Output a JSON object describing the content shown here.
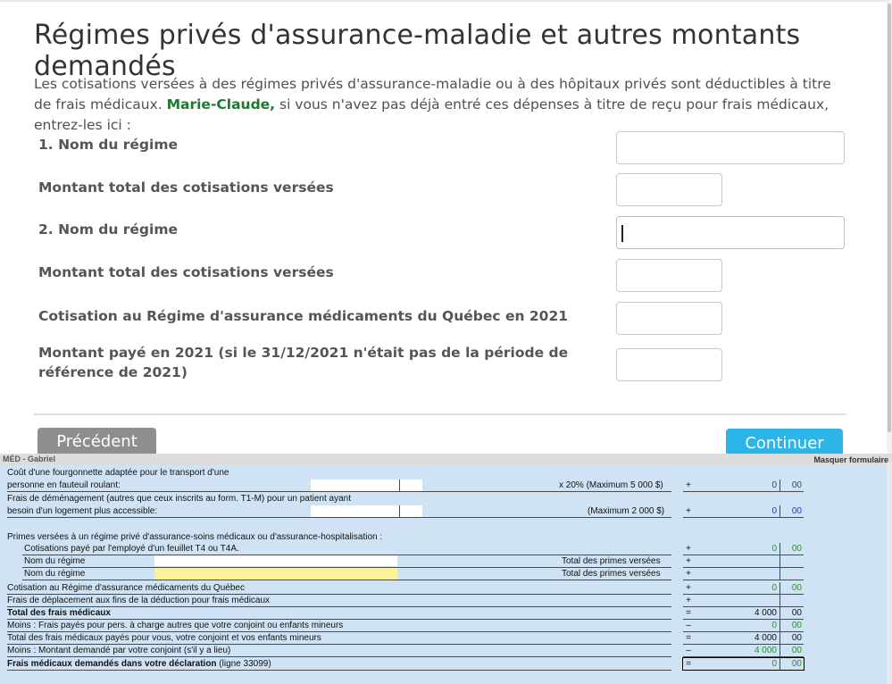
{
  "page": {
    "title": "Régimes privés d'assurance-maladie et autres montants demandés",
    "intro_before": "Les cotisations versées à des régimes privés d'assurance-maladie ou à des hôpitaux privés sont déductibles à titre de frais médicaux. ",
    "intro_name": "Marie-Claude,",
    "intro_after": " si vous n'avez pas déjà entré ces dépenses à titre de reçu pour frais médicaux, entrez-les ici :",
    "fields": [
      {
        "label": "1. Nom du régime",
        "value": ""
      },
      {
        "label": "Montant total des cotisations versées",
        "value": ""
      },
      {
        "label": "2. Nom du régime",
        "value": ""
      },
      {
        "label": "Montant total des cotisations versées",
        "value": ""
      },
      {
        "label": "Cotisation au Régime d'assurance médicaments du Québec en 2021",
        "value": ""
      },
      {
        "label": "Montant payé en 2021 (si le 31/12/2021 n'était pas de la période de référence de 2021)",
        "value": ""
      }
    ],
    "prev_button": "Précédent",
    "next_button": "Continuer"
  },
  "form": {
    "header_title": "MÉD - Gabriel",
    "hide_form": "Masquer formulaire",
    "rows": {
      "van1": "Coût d'une fourgonnette adaptée pour le transport d'une",
      "van2": "personne en fauteuil roulant:",
      "van_calc": "x 20% (Maximum 5 000 $)",
      "move1": "Frais de déménagement (autres que ceux inscrits au form. T1-M) pour un patient ayant",
      "move2": "besoin d'un logement plus accessible:",
      "move_calc": "(Maximum 2 000 $)",
      "premiums": "Primes versées à un régime privé d'assurance-soins médicaux ou d'assurance-hospitalisation :",
      "employer": "Cotisations payé par l'employé d'un feuillet T4 ou T4A.",
      "plan_name1": "Nom du régime",
      "plan_total1": "Total des primes versées",
      "plan_name2": "Nom du régime",
      "plan_total2": "Total des primes versées",
      "ramq": "Cotisation au Régime d'assurance médicaments du Québec",
      "travel": "Frais de déplacement aux fins de  la déduction pour frais médicaux",
      "total_med": "Total des frais médicaux",
      "less_dep": "Moins : Frais payés pour pers. à charge autres que votre conjoint ou enfants mineurs",
      "total_family": "Total des frais médicaux payés pour vous, votre conjoint et vos enfants mineurs",
      "less_spouse": "Moins : Montant demandé par votre conjoint (s'il y a lieu)",
      "claimed_bold": "Frais médicaux demandés dans votre déclaration",
      "claimed_line": " (ligne 33099)"
    },
    "signs": {
      "van": "+",
      "move": "+",
      "employer": "+",
      "plan1": "+",
      "plan2": "+",
      "ramq": "+",
      "travel": "+",
      "total_med": "=",
      "less_dep": "–",
      "total_family": "=",
      "less_spouse": "–",
      "claimed": "="
    },
    "amounts": {
      "van": "0",
      "van_c": "00",
      "move": "0",
      "move_c": "00",
      "employer": "0",
      "employer_c": "00",
      "ramq": "0",
      "ramq_c": "00",
      "total_med": "4 000",
      "total_med_c": "00",
      "less_dep": "0",
      "less_dep_c": "00",
      "total_family": "4 000",
      "total_family_c": "00",
      "less_spouse": "4 000",
      "less_spouse_c": "00",
      "claimed": "0",
      "claimed_c": "00"
    }
  },
  "colors": {
    "accent": "#2cb5e8",
    "name_green": "#1b7a2e",
    "form_bg": "#cfe3f4",
    "highlight_yellow": "#fbf29a"
  }
}
